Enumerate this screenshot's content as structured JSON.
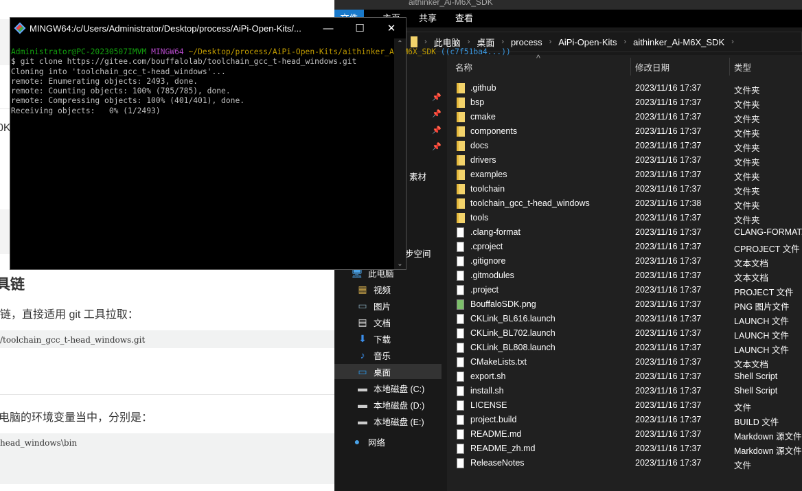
{
  "web_page": {
    "partial_text_1": "0K",
    "heading": "具链",
    "paragraph_1": "链，直接适用 git 工具拉取：",
    "code_1": "/toolchain_gcc_t-head_windows.git",
    "paragraph_2": "电脑的环境变量当中，分别是：",
    "code_2": "head_windows\\bin"
  },
  "terminal": {
    "title": "MINGW64:/c/Users/Administrator/Desktop/process/AiPi-Open-Kits/...",
    "prompt_user": "Administrator@PC-20230507IMVM",
    "prompt_env": "MINGW64",
    "prompt_path": "~/Desktop/process/AiPi-Open-Kits/aithinker_Ai-M6X_SDK",
    "prompt_branch": "((c7f51ba4...))",
    "lines": [
      "$ git clone https://gitee.com/bouffalolab/toolchain_gcc_t-head_windows.git",
      "Cloning into 'toolchain_gcc_t-head_windows'...",
      "remote: Enumerating objects: 2493, done.",
      "remote: Counting objects: 100% (785/785), done.",
      "remote: Compressing objects: 100% (401/401), done.",
      "Receiving objects:   0% (1/2493)"
    ],
    "colors": {
      "user": "#13a10e",
      "env": "#b148c6",
      "path": "#c19c00",
      "branch": "#3a96dd"
    }
  },
  "explorer": {
    "title": "aithinker_Ai-M6X_SDK",
    "ribbon_tabs": [
      "文件",
      "主页",
      "共享",
      "查看"
    ],
    "accent": "#1979ca",
    "breadcrumb": [
      "此电脑",
      "桌面",
      "process",
      "AiPi-Open-Kits",
      "aithinker_Ai-M6X_SDK"
    ],
    "nav_partial": [
      "素材",
      "步空间"
    ],
    "nav": [
      {
        "label": "此电脑",
        "icon": "computer-icon"
      },
      {
        "label": "视频",
        "icon": "video-icon"
      },
      {
        "label": "图片",
        "icon": "picture-icon"
      },
      {
        "label": "文档",
        "icon": "document-icon"
      },
      {
        "label": "下载",
        "icon": "download-icon"
      },
      {
        "label": "音乐",
        "icon": "music-icon"
      },
      {
        "label": "桌面",
        "icon": "desktop-icon",
        "selected": true
      },
      {
        "label": "本地磁盘 (C:)",
        "icon": "drive-icon"
      },
      {
        "label": "本地磁盘 (D:)",
        "icon": "drive-icon"
      },
      {
        "label": "本地磁盘 (E:)",
        "icon": "drive-icon"
      },
      {
        "label": "网络",
        "icon": "network-icon"
      }
    ],
    "columns": [
      "名称",
      "修改日期",
      "类型"
    ],
    "files": [
      {
        "name": ".github",
        "date": "2023/11/16 17:37",
        "type": "文件夹",
        "icon": "folder"
      },
      {
        "name": "bsp",
        "date": "2023/11/16 17:37",
        "type": "文件夹",
        "icon": "folder"
      },
      {
        "name": "cmake",
        "date": "2023/11/16 17:37",
        "type": "文件夹",
        "icon": "folder"
      },
      {
        "name": "components",
        "date": "2023/11/16 17:37",
        "type": "文件夹",
        "icon": "folder"
      },
      {
        "name": "docs",
        "date": "2023/11/16 17:37",
        "type": "文件夹",
        "icon": "folder"
      },
      {
        "name": "drivers",
        "date": "2023/11/16 17:37",
        "type": "文件夹",
        "icon": "folder"
      },
      {
        "name": "examples",
        "date": "2023/11/16 17:37",
        "type": "文件夹",
        "icon": "folder"
      },
      {
        "name": "toolchain",
        "date": "2023/11/16 17:37",
        "type": "文件夹",
        "icon": "folder"
      },
      {
        "name": "toolchain_gcc_t-head_windows",
        "date": "2023/11/16 17:38",
        "type": "文件夹",
        "icon": "folder"
      },
      {
        "name": "tools",
        "date": "2023/11/16 17:37",
        "type": "文件夹",
        "icon": "folder"
      },
      {
        "name": ".clang-format",
        "date": "2023/11/16 17:37",
        "type": "CLANG-FORMAT...",
        "icon": "doc"
      },
      {
        "name": ".cproject",
        "date": "2023/11/16 17:37",
        "type": "CPROJECT 文件",
        "icon": "doc"
      },
      {
        "name": ".gitignore",
        "date": "2023/11/16 17:37",
        "type": "文本文档",
        "icon": "doc"
      },
      {
        "name": ".gitmodules",
        "date": "2023/11/16 17:37",
        "type": "文本文档",
        "icon": "doc"
      },
      {
        "name": ".project",
        "date": "2023/11/16 17:37",
        "type": "PROJECT 文件",
        "icon": "doc"
      },
      {
        "name": "BouffaloSDK.png",
        "date": "2023/11/16 17:37",
        "type": "PNG 图片文件",
        "icon": "image"
      },
      {
        "name": "CKLink_BL616.launch",
        "date": "2023/11/16 17:37",
        "type": "LAUNCH 文件",
        "icon": "doc"
      },
      {
        "name": "CKLink_BL702.launch",
        "date": "2023/11/16 17:37",
        "type": "LAUNCH 文件",
        "icon": "doc"
      },
      {
        "name": "CKLink_BL808.launch",
        "date": "2023/11/16 17:37",
        "type": "LAUNCH 文件",
        "icon": "doc"
      },
      {
        "name": "CMakeLists.txt",
        "date": "2023/11/16 17:37",
        "type": "文本文档",
        "icon": "doc"
      },
      {
        "name": "export.sh",
        "date": "2023/11/16 17:37",
        "type": "Shell Script",
        "icon": "doc"
      },
      {
        "name": "install.sh",
        "date": "2023/11/16 17:37",
        "type": "Shell Script",
        "icon": "doc"
      },
      {
        "name": "LICENSE",
        "date": "2023/11/16 17:37",
        "type": "文件",
        "icon": "doc"
      },
      {
        "name": "project.build",
        "date": "2023/11/16 17:37",
        "type": "BUILD 文件",
        "icon": "doc"
      },
      {
        "name": "README.md",
        "date": "2023/11/16 17:37",
        "type": "Markdown 源文件",
        "icon": "doc"
      },
      {
        "name": "README_zh.md",
        "date": "2023/11/16 17:37",
        "type": "Markdown 源文件",
        "icon": "doc"
      },
      {
        "name": "ReleaseNotes",
        "date": "2023/11/16 17:37",
        "type": "文件",
        "icon": "doc"
      }
    ]
  }
}
